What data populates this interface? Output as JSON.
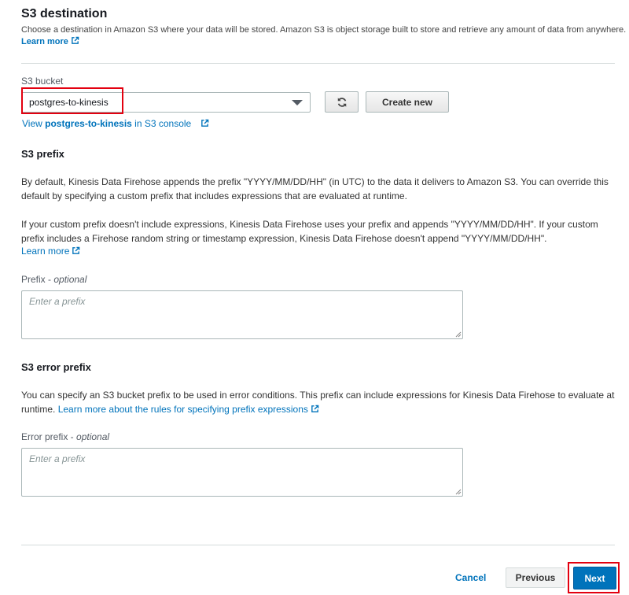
{
  "s3_destination": {
    "title": "S3 destination",
    "description": "Choose a destination in Amazon S3 where your data will be stored. Amazon S3 is object storage built to store and retrieve any amount of data from anywhere.",
    "learn_more": "Learn more"
  },
  "bucket": {
    "label": "S3 bucket",
    "selected": "postgres-to-kinesis",
    "create_new": "Create new",
    "view_prefix": "View ",
    "view_bucket": "postgres-to-kinesis",
    "view_suffix": " in S3 console",
    "refresh_icon": "refresh-icon",
    "dropdown_icon": "chevron-down-icon"
  },
  "s3_prefix": {
    "heading": "S3 prefix",
    "para1": "By default, Kinesis Data Firehose appends the prefix \"YYYY/MM/DD/HH\" (in UTC) to the data it delivers to Amazon S3. You can override this default by specifying a custom prefix that includes expressions that are evaluated at runtime.",
    "para2": "If your custom prefix doesn't include expressions, Kinesis Data Firehose uses your prefix and appends \"YYYY/MM/DD/HH\". If your custom prefix includes a Firehose random string or timestamp expression, Kinesis Data Firehose doesn't append \"YYYY/MM/DD/HH\".",
    "learn_more": "Learn more",
    "field_label": "Prefix",
    "field_optional": "optional",
    "placeholder": "Enter a prefix"
  },
  "s3_error_prefix": {
    "heading": "S3 error prefix",
    "para": "You can specify an S3 bucket prefix to be used in error conditions. This prefix can include expressions for Kinesis Data Firehose to evaluate at runtime.",
    "link": "Learn more about the rules for specifying prefix expressions",
    "field_label": "Error prefix",
    "field_optional": "optional",
    "placeholder": "Enter a prefix"
  },
  "footer": {
    "cancel": "Cancel",
    "previous": "Previous",
    "next": "Next"
  },
  "colors": {
    "link": "#0073bb",
    "primary": "#0073bb",
    "highlight": "#e3000f"
  }
}
